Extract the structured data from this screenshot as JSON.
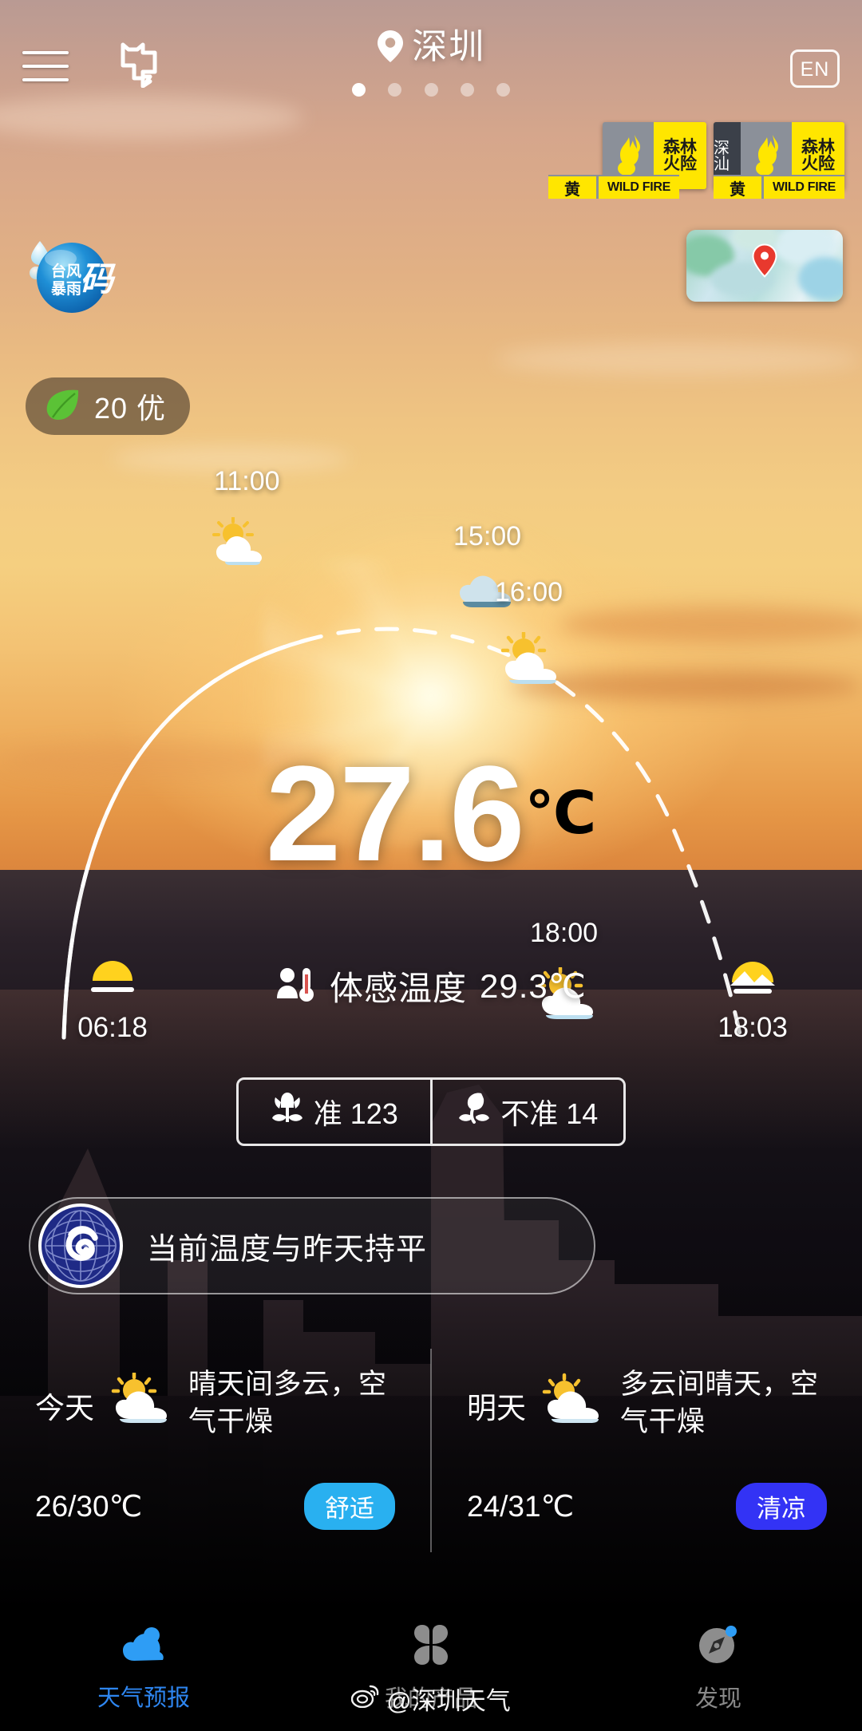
{
  "header": {
    "city": "深圳",
    "location_icon": "location-pin-icon",
    "menu_icon": "hamburger-menu-icon",
    "add_city_icon": "add-city-icon",
    "language_label": "EN",
    "page_dots": 5,
    "active_dot": 0
  },
  "warnings": [
    {
      "region": "",
      "title_line1": "森林",
      "title_line2": "火险",
      "level": "黄",
      "en": "WILD FIRE",
      "icon": "wildfire-icon"
    },
    {
      "region": "深汕",
      "title_line1": "森林",
      "title_line2": "火险",
      "level": "黄",
      "en": "WILD FIRE",
      "icon": "wildfire-icon"
    }
  ],
  "typhoon_badge": {
    "line1": "台风",
    "line2": "暴雨",
    "big": "码",
    "icon": "typhoon-rainstorm-code-icon"
  },
  "radar": {
    "label": "radar-map-thumbnail",
    "pin_icon": "map-pin-icon"
  },
  "aqi": {
    "icon": "green-leaf-icon",
    "value": "20",
    "level": "优",
    "text": "20 优"
  },
  "sun_arc": {
    "points": [
      {
        "time": "11:00",
        "icon": "sun-behind-cloud-icon"
      },
      {
        "time": "15:00",
        "icon": "cloud-icon"
      },
      {
        "time": "16:00",
        "icon": "sun-behind-cloud-icon"
      },
      {
        "time": "18:00",
        "icon": "sun-behind-cloud-icon"
      }
    ],
    "sunrise": {
      "time": "06:18",
      "icon": "sunrise-icon"
    },
    "sunset": {
      "time": "18:03",
      "icon": "sunset-icon"
    }
  },
  "current": {
    "temperature": "27.6",
    "unit": "℃",
    "feels_icon": "person-thermometer-icon",
    "feels_label": "体感温度",
    "feels_value": "29.3℃"
  },
  "vote": {
    "accurate": {
      "icon": "blooming-flower-icon",
      "label": "准",
      "count": "123",
      "text": "准 123"
    },
    "inaccurate": {
      "icon": "wilted-flower-icon",
      "label": "不准",
      "count": "14",
      "text": "不准 14"
    }
  },
  "notice": {
    "logo": "cma-logo-icon",
    "message": "当前温度与昨天持平"
  },
  "forecast": [
    {
      "day": "今天",
      "icon": "sun-behind-cloud-icon",
      "desc": "晴天间多云，空气干燥",
      "range": "26/30℃",
      "tag": "舒适",
      "tag_color": "#29b0f0"
    },
    {
      "day": "明天",
      "icon": "sun-behind-cloud-icon",
      "desc": "多云间晴天，空气干燥",
      "range": "24/31℃",
      "tag": "清凉",
      "tag_color": "#3333f5"
    }
  ],
  "nav": [
    {
      "label": "天气预报",
      "icon": "cloud-forecast-icon",
      "active": true
    },
    {
      "label": "我的产品",
      "icon": "four-petal-grid-icon",
      "active": false
    },
    {
      "label": "发现",
      "icon": "compass-discover-icon",
      "active": false
    }
  ],
  "watermark": {
    "icon": "weibo-icon",
    "text": "@深圳天气"
  },
  "colors": {
    "accent_blue": "#2e86f0",
    "warning_yellow": "#ffe600",
    "comfort_tag": "#29b0f0",
    "cool_tag": "#3333f5",
    "aqi_green": "#5bc236"
  }
}
